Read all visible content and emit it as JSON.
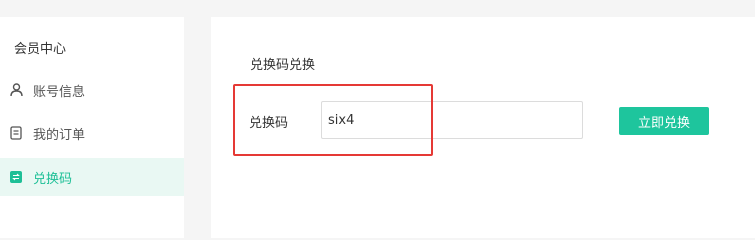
{
  "sidebar": {
    "title": "会员中心",
    "items": [
      {
        "label": "账号信息",
        "icon": "user-icon",
        "active": false
      },
      {
        "label": "我的订单",
        "icon": "document-icon",
        "active": false
      },
      {
        "label": "兑换码",
        "icon": "exchange-icon",
        "active": true
      }
    ]
  },
  "main": {
    "section_title": "兑换码兑换",
    "field_label": "兑换码",
    "code_value": "six4",
    "redeem_label": "立即兑换"
  },
  "colors": {
    "accent": "#1ec59d",
    "active_bg": "#e9f8f3",
    "highlight": "#e53935"
  }
}
